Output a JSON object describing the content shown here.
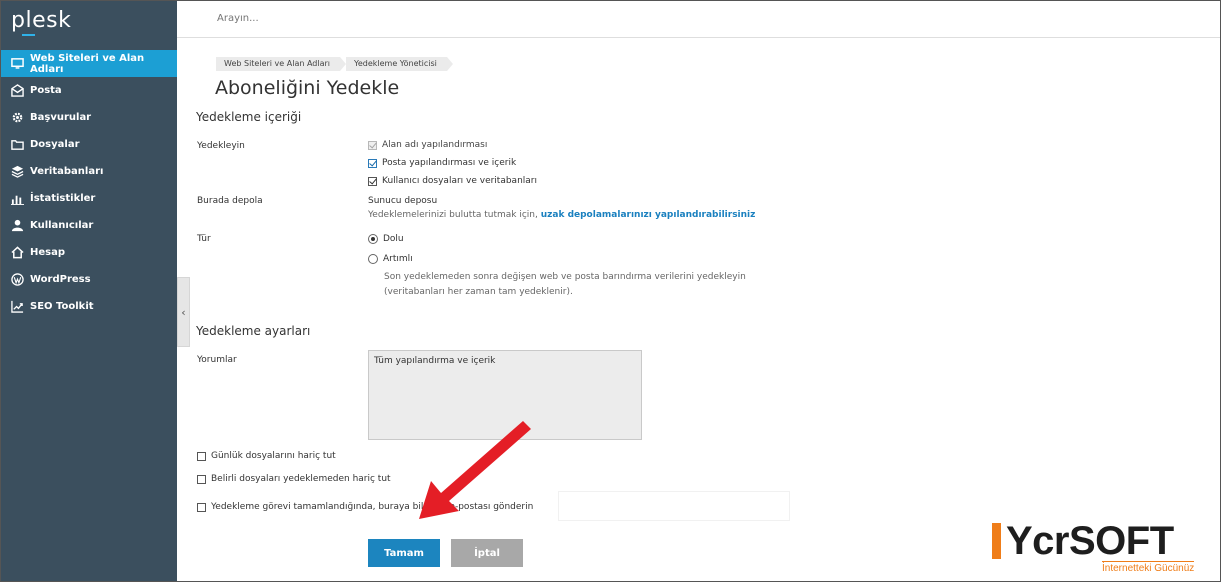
{
  "app": {
    "logo_text": "plesk"
  },
  "search": {
    "placeholder": "Arayın..."
  },
  "sidebar": {
    "items": [
      {
        "label": "Web Siteleri ve Alan Adları",
        "icon": "monitor-icon"
      },
      {
        "label": "Posta",
        "icon": "mail-icon"
      },
      {
        "label": "Başvurular",
        "icon": "gear-icon"
      },
      {
        "label": "Dosyalar",
        "icon": "folder-icon"
      },
      {
        "label": "Veritabanları",
        "icon": "layers-icon"
      },
      {
        "label": "İstatistikler",
        "icon": "bar-chart-icon"
      },
      {
        "label": "Kullanıcılar",
        "icon": "user-icon"
      },
      {
        "label": "Hesap",
        "icon": "house-icon"
      },
      {
        "label": "WordPress",
        "icon": "wordpress-icon"
      },
      {
        "label": "SEO Toolkit",
        "icon": "trend-icon"
      }
    ],
    "collapse_glyph": "‹"
  },
  "breadcrumb": [
    "Web Siteleri ve Alan Adları",
    "Yedekleme Yöneticisi"
  ],
  "page_title": "Aboneliğini Yedekle",
  "content_section": {
    "title": "Yedekleme içeriği",
    "backup_label": "Yedekleyin",
    "options": [
      {
        "label": "Alan adı yapılandırması",
        "checked": true,
        "disabled": true
      },
      {
        "label": "Posta yapılandırması ve içerik",
        "checked": true,
        "disabled": false
      },
      {
        "label": "Kullanıcı dosyaları ve veritabanları",
        "checked": true,
        "disabled": false
      }
    ],
    "storage_label": "Burada depola",
    "storage_value": "Sunucu deposu",
    "storage_hint": "Yedeklemelerinizi bulutta tutmak için,",
    "storage_link": "uzak depolamalarınızı yapılandırabilirsiniz",
    "type_label": "Tür",
    "type_full": "Dolu",
    "type_incremental": "Artımlı",
    "type_hint_line1": "Son yedeklemeden sonra değişen web ve posta barındırma verilerini yedekleyin",
    "type_hint_line2": "(veritabanları her zaman tam yedeklenir)."
  },
  "settings_section": {
    "title": "Yedekleme ayarları",
    "comments_label": "Yorumlar",
    "comments_value": "Tüm yapılandırma ve içerik",
    "exclude_logs": "Günlük dosyalarını hariç tut",
    "exclude_files": "Belirli dosyaları yedeklemeden hariç tut",
    "notify_email": "Yedekleme görevi tamamlandığında, buraya bildirim e-postası gönderin"
  },
  "buttons": {
    "ok": "Tamam",
    "cancel": "İptal"
  },
  "watermark": {
    "brand": "YcrSOFT",
    "tagline": "İnternetteki Gücünüz"
  },
  "colors": {
    "sidebar_bg": "#3b4f5e",
    "active_item": "#1c9fd4",
    "primary_button": "#1c85bf",
    "cancel_button": "#a8a8a8",
    "link": "#1a80bf",
    "arrow": "#e41e26",
    "watermark_accent": "#ef7d19"
  }
}
